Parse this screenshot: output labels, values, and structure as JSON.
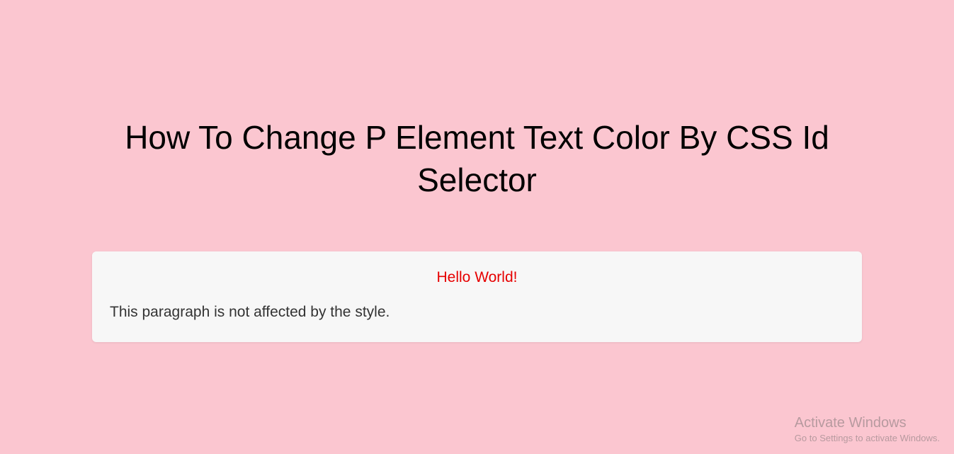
{
  "page": {
    "title": "How To Change P Element Text Color By CSS Id Selector"
  },
  "example": {
    "styled_paragraph": "Hello World!",
    "unstyled_paragraph": "This paragraph is not affected by the style."
  },
  "watermark": {
    "title": "Activate Windows",
    "subtitle": "Go to Settings to activate Windows."
  }
}
